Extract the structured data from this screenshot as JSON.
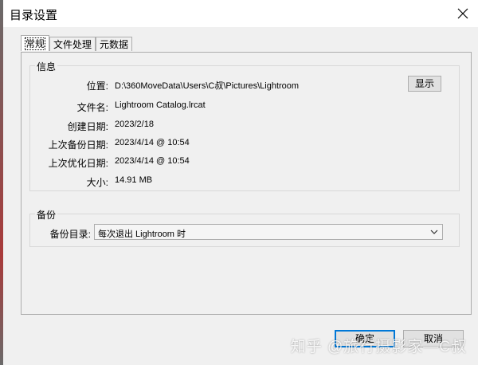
{
  "window": {
    "title": "目录设置"
  },
  "tabs": [
    {
      "label": "常规",
      "active": true
    },
    {
      "label": "文件处理",
      "active": false
    },
    {
      "label": "元数据",
      "active": false
    }
  ],
  "info": {
    "legend": "信息",
    "rows": [
      {
        "key": "位置:",
        "value": "D:\\360MoveData\\Users\\C叔\\Pictures\\Lightroom"
      },
      {
        "key": "文件名:",
        "value": "Lightroom Catalog.lrcat"
      },
      {
        "key": "创建日期:",
        "value": "2023/2/18"
      },
      {
        "key": "上次备份日期:",
        "value": "2023/4/14 @ 10:54"
      },
      {
        "key": "上次优化日期:",
        "value": "2023/4/14 @ 10:54"
      },
      {
        "key": "大小:",
        "value": "14.91 MB"
      }
    ],
    "show_button": "显示"
  },
  "backup": {
    "legend": "备份",
    "label": "备份目录:",
    "selected": "每次退出 Lightroom 时"
  },
  "footer": {
    "ok": "确定",
    "cancel": "取消"
  },
  "watermark": "知乎 @旅行摄影家—C叔",
  "colors": {
    "accent": "#0078d7",
    "border": "#adadad",
    "bg": "#f0f0f0"
  }
}
